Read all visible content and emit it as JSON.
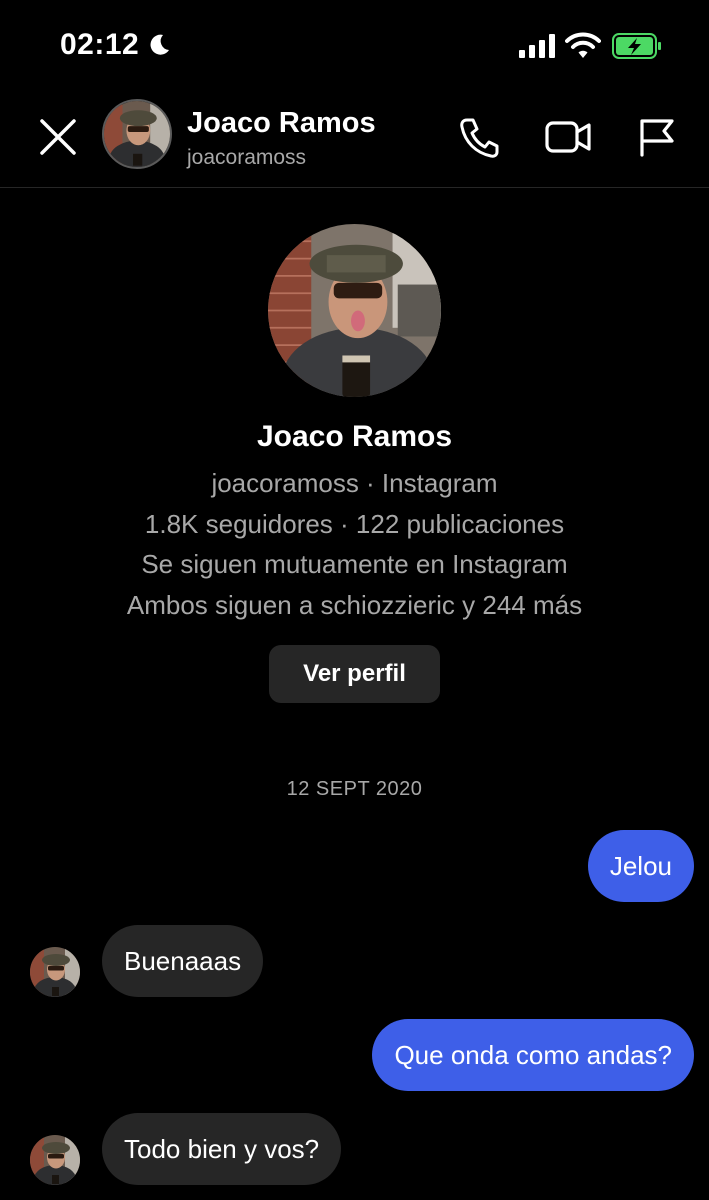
{
  "status_bar": {
    "time": "02:12",
    "icons": [
      "moon-icon",
      "cellular-signal-icon",
      "wifi-icon",
      "battery-charging-icon"
    ],
    "battery_color": "#4cd964"
  },
  "header": {
    "name": "Joaco Ramos",
    "username": "joacoramoss",
    "icons": [
      "close-icon",
      "phone-icon",
      "video-camera-icon",
      "flag-icon"
    ]
  },
  "profile": {
    "name": "Joaco Ramos",
    "username_line": "joacoramoss · Instagram",
    "stats_line": "1.8K seguidores · 122 publicaciones",
    "mutual_line": "Se siguen mutuamente en Instagram",
    "followers_line": "Ambos siguen a schiozzieric y 244 más",
    "view_profile_label": "Ver perfil"
  },
  "conversation": {
    "date_separator": "12 SEPT 2020",
    "messages": [
      {
        "from": "me",
        "text": "Jelou"
      },
      {
        "from": "them",
        "text": "Buenaaas"
      },
      {
        "from": "me",
        "text": "Que onda como andas?"
      },
      {
        "from": "them",
        "text": "Todo bien y vos?"
      }
    ]
  },
  "colors": {
    "background": "#000000",
    "outgoing_bubble": "#3e5fe8",
    "incoming_bubble": "#262626",
    "secondary_text": "#a8a8a8"
  }
}
